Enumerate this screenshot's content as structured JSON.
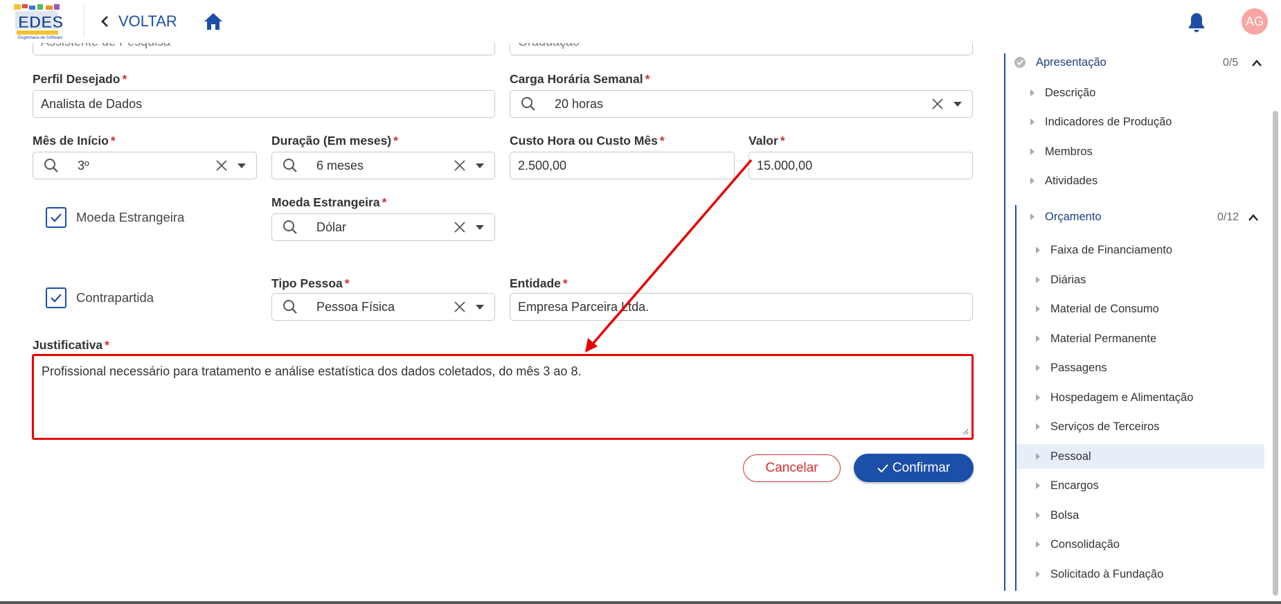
{
  "header": {
    "logo_text": "EDES",
    "logo_subtext": "Engenharia de Software",
    "back_label": "VOLTAR",
    "avatar_initials": "AG"
  },
  "form": {
    "top_left_value": "Assistente de Pesquisa",
    "top_right_value": "Graduação",
    "perfil": {
      "label": "Perfil Desejado",
      "required": "*",
      "value": "Analista de Dados"
    },
    "carga": {
      "label": "Carga Horária Semanal",
      "required": "*",
      "value": "20 horas"
    },
    "mes_inicio": {
      "label": "Mês de Início",
      "required": "*",
      "value": "3º"
    },
    "duracao": {
      "label": "Duração (Em meses)",
      "required": "*",
      "value": "6 meses"
    },
    "custo": {
      "label": "Custo Hora ou Custo Mês",
      "required": "*",
      "value": "2.500,00"
    },
    "valor": {
      "label": "Valor",
      "required": "*",
      "value": "15.000,00"
    },
    "moeda_checkbox": {
      "label": "Moeda Estrangeira",
      "checked": true
    },
    "moeda": {
      "label": "Moeda Estrangeira",
      "required": "*",
      "value": "Dólar"
    },
    "contrapartida_checkbox": {
      "label": "Contrapartida",
      "checked": true
    },
    "tipo_pessoa": {
      "label": "Tipo Pessoa",
      "required": "*",
      "value": "Pessoa Física"
    },
    "entidade": {
      "label": "Entidade",
      "required": "*",
      "value": "Empresa Parceira Ltda."
    },
    "justificativa": {
      "label": "Justificativa",
      "required": "*",
      "value": "Profissional necessário para tratamento e análise estatística dos dados coletados, do mês 3 ao 8."
    }
  },
  "buttons": {
    "cancel": "Cancelar",
    "confirm": "Confirmar"
  },
  "sidebar": {
    "apresentacao": {
      "label": "Apresentação",
      "count": "0/5",
      "items": [
        "Descrição",
        "Indicadores de Produção",
        "Membros",
        "Atividades"
      ]
    },
    "orcamento": {
      "label": "Orçamento",
      "count": "0/12",
      "items": [
        "Faixa de Financiamento",
        "Diárias",
        "Material de Consumo",
        "Material Permanente",
        "Passagens",
        "Hospedagem e Alimentação",
        "Serviços de Terceiros",
        "Pessoal",
        "Encargos",
        "Bolsa",
        "Consolidação",
        "Solicitado à Fundação"
      ],
      "active": "Pessoal"
    }
  },
  "colors": {
    "primary": "#1b4fa8",
    "danger": "#d32f2f",
    "annotation": "#e60000",
    "avatar": "#f8a5a3"
  }
}
